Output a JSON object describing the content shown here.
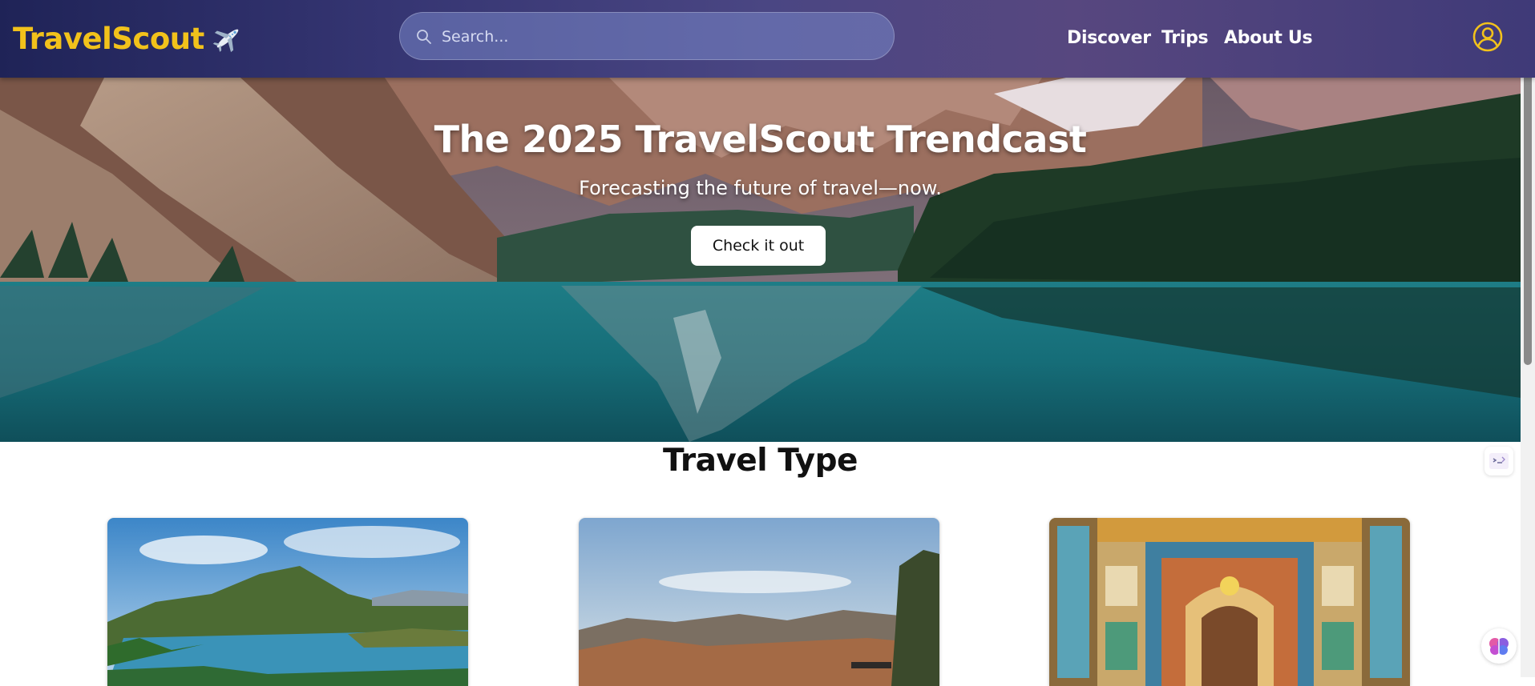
{
  "header": {
    "logo_text": "TravelScout",
    "logo_icon": "airplane-icon",
    "search": {
      "placeholder": "Search...",
      "value": ""
    },
    "nav": [
      {
        "label": "Discover"
      },
      {
        "label": "Trips"
      },
      {
        "label": "About Us"
      }
    ],
    "user_icon": "user-circle-icon"
  },
  "hero": {
    "title": "The 2025 TravelScout Trendcast",
    "subtitle": "Forecasting the future of travel—now.",
    "cta_label": "Check it out"
  },
  "section": {
    "title": "Travel Type",
    "cards": [
      {
        "image": "lake-hills-town"
      },
      {
        "image": "desert-mountains-sky"
      },
      {
        "image": "ornate-painted-doorway"
      }
    ]
  },
  "colors": {
    "brand_yellow": "#f2c21b",
    "header_gradient_start": "#1f2357",
    "header_gradient_end": "#57477f",
    "cta_background": "#ffffff"
  },
  "widgets": [
    {
      "icon": "terminal-icon"
    },
    {
      "icon": "brain-icon"
    }
  ]
}
